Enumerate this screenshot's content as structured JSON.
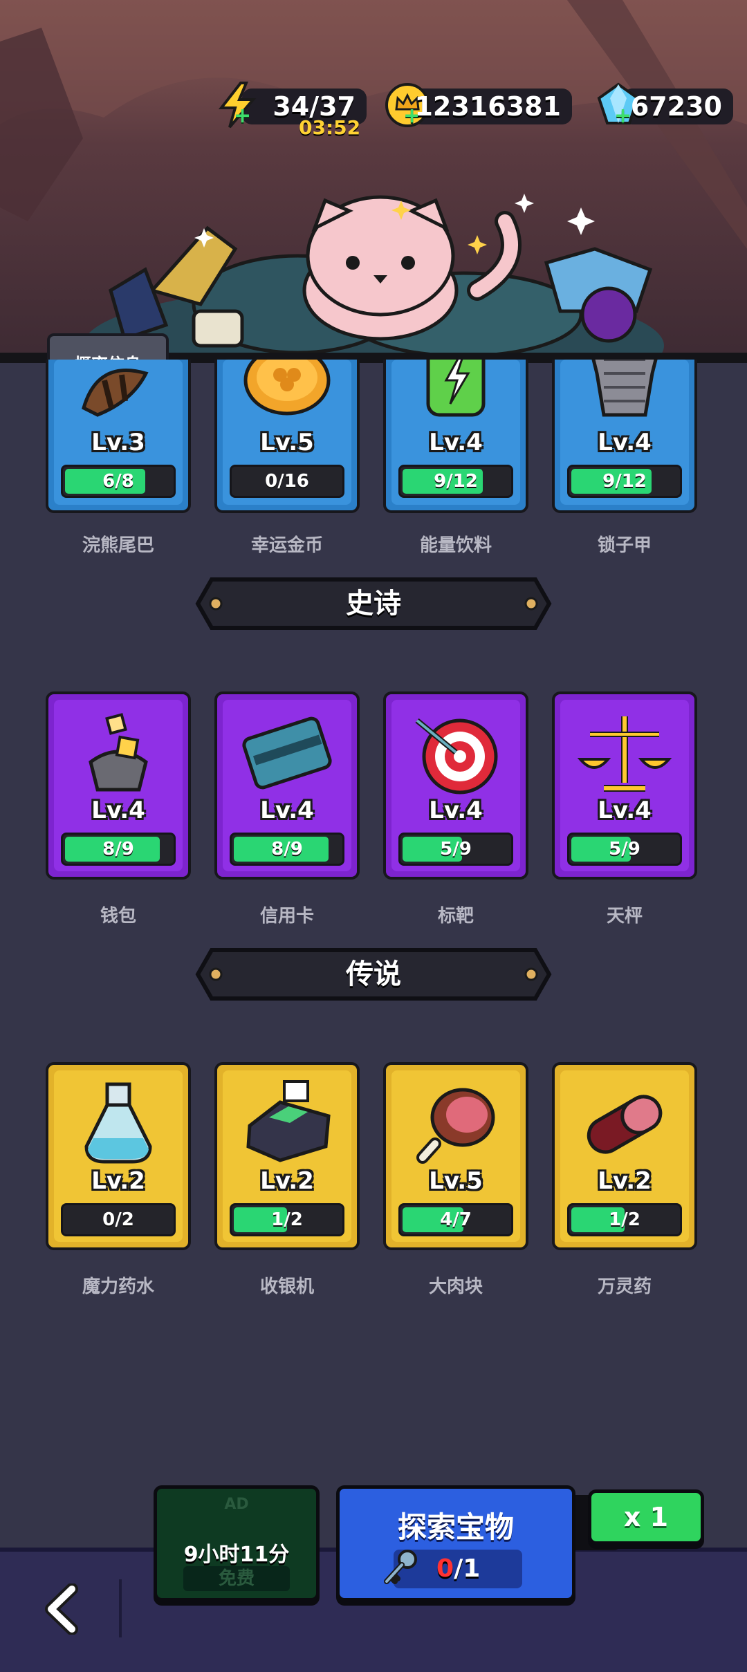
{
  "resources": {
    "energy": "34/37",
    "energy_timer": "03:52",
    "gold": "12316381",
    "gems": "67230",
    "plus": "+"
  },
  "prob_button": "概率信息",
  "rare_items": [
    {
      "level": "Lv.3",
      "progress": "6/8",
      "fill": 0.75,
      "name": "浣熊尾巴",
      "icon": "raccoon-tail-icon"
    },
    {
      "level": "Lv.5",
      "progress": "0/16",
      "fill": 0,
      "name": "幸运金币",
      "icon": "lucky-coin-icon"
    },
    {
      "level": "Lv.4",
      "progress": "9/12",
      "fill": 0.75,
      "name": "能量饮料",
      "icon": "energy-drink-icon"
    },
    {
      "level": "Lv.4",
      "progress": "9/12",
      "fill": 0.75,
      "name": "锁子甲",
      "icon": "chainmail-icon"
    }
  ],
  "epic_header": "史诗",
  "epic_items": [
    {
      "level": "Lv.4",
      "progress": "8/9",
      "fill": 0.89,
      "name": "钱包",
      "icon": "wallet-icon"
    },
    {
      "level": "Lv.4",
      "progress": "8/9",
      "fill": 0.89,
      "name": "信用卡",
      "icon": "credit-card-icon"
    },
    {
      "level": "Lv.4",
      "progress": "5/9",
      "fill": 0.56,
      "name": "标靶",
      "icon": "target-icon"
    },
    {
      "level": "Lv.4",
      "progress": "5/9",
      "fill": 0.56,
      "name": "天枰",
      "icon": "scale-icon"
    }
  ],
  "legend_header": "传说",
  "legend_items": [
    {
      "level": "Lv.2",
      "progress": "0/2",
      "fill": 0,
      "name": "魔力药水",
      "icon": "potion-icon"
    },
    {
      "level": "Lv.2",
      "progress": "1/2",
      "fill": 0.5,
      "name": "收银机",
      "icon": "cash-register-icon"
    },
    {
      "level": "Lv.5",
      "progress": "4/7",
      "fill": 0.57,
      "name": "大肉块",
      "icon": "meat-icon"
    },
    {
      "level": "Lv.2",
      "progress": "1/2",
      "fill": 0.5,
      "name": "万灵药",
      "icon": "pill-icon"
    }
  ],
  "ad_button": {
    "ad_label": "AD",
    "free_label": "免费",
    "time": "9小时11分"
  },
  "explore_button": {
    "title": "探索宝物",
    "count_current": "0",
    "count_total": "/1"
  },
  "multiplier": "x 1",
  "colors": {
    "rare": "#2b80c9",
    "epic": "#7d24cf",
    "legend": "#e2b22a",
    "progress": "#2ad673",
    "background": "#353549"
  }
}
